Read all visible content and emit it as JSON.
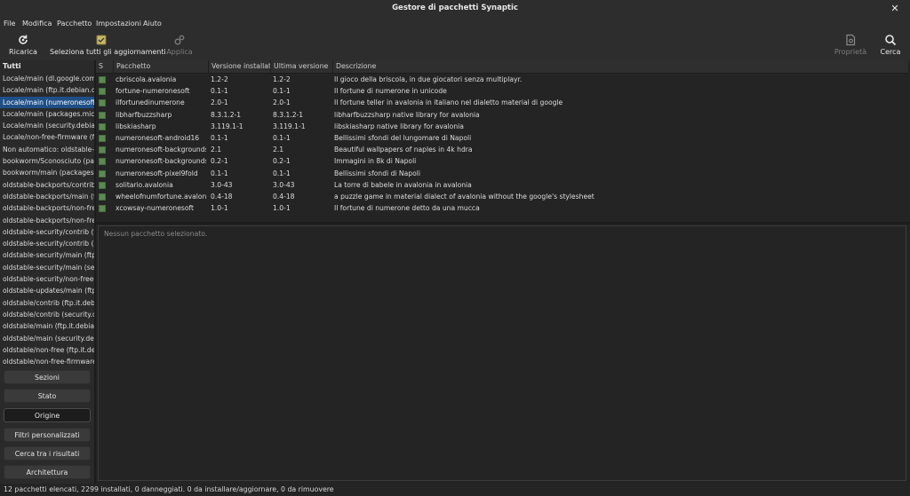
{
  "window": {
    "title": "Gestore di pacchetti Synaptic",
    "close_glyph": "✕"
  },
  "menu": [
    "File",
    "Modifica",
    "Pacchetto",
    "Impostazioni",
    "Aiuto"
  ],
  "toolbar": {
    "reload": "Ricarica",
    "mark_upgrades": "Seleziona tutti gli aggiornamenti",
    "apply": "Applica",
    "properties": "Proprietà",
    "search": "Cerca"
  },
  "sidebar": {
    "header": "Tutti",
    "items": [
      "Locale/main (dl.google.com)",
      "Locale/main (ftp.it.debian.org)",
      "Locale/main (numeronesoft.dev)",
      "Locale/main (packages.microsoft.com)",
      "Locale/main (security.debian.org)",
      "Locale/non-free-firmware (ftp.it.debian.org)",
      "Non automatico: oldstable-backports",
      "bookworm/Sconosciuto (packages)",
      "bookworm/main (packages.microsoft.com)",
      "oldstable-backports/contrib (ftp.it.debian.org)",
      "oldstable-backports/main (ftp.it.debian.org)",
      "oldstable-backports/non-free",
      "oldstable-backports/non-free-firmware",
      "oldstable-security/contrib (ftp.it.debian.org)",
      "oldstable-security/contrib (security.debian.org)",
      "oldstable-security/main (ftp.it.debian.org)",
      "oldstable-security/main (security.debian.org)",
      "oldstable-security/non-free-firmware",
      "oldstable-updates/main (ftp.it.debian.org)",
      "oldstable/contrib (ftp.it.debian.org)",
      "oldstable/contrib (security.debian.org)",
      "oldstable/main (ftp.it.debian.org)",
      "oldstable/main (security.debian.org)",
      "oldstable/non-free (ftp.it.debian.org)",
      "oldstable/non-free-firmware (ftp.it.debian.org)"
    ],
    "selected_index": 2,
    "buttons": [
      "Sezioni",
      "Stato",
      "Origine",
      "Filtri personalizzati",
      "Cerca tra i risultati",
      "Architettura"
    ],
    "active_button_index": 2
  },
  "table": {
    "columns": [
      "S",
      "Pacchetto",
      "Versione installata",
      "Ultima versione",
      "Descrizione"
    ],
    "rows": [
      {
        "name": "cbriscola.avalonia",
        "installed": "1.2-2",
        "latest": "1.2-2",
        "desc": "Il gioco della briscola, in due giocatori senza multiplayr."
      },
      {
        "name": "fortune-numeronesoft",
        "installed": "0.1-1",
        "latest": "0.1-1",
        "desc": "Il fortune di numerone in unicode"
      },
      {
        "name": "ilfortunedinumerone",
        "installed": "2.0-1",
        "latest": "2.0-1",
        "desc": "Il fortune teller in avalonia in italiano nel dialetto material di google"
      },
      {
        "name": "libharfbuzzsharp",
        "installed": "8.3.1.2-1",
        "latest": "8.3.1.2-1",
        "desc": "libharfbuzzsharp native library for avalonia"
      },
      {
        "name": "libskiasharp",
        "installed": "3.119.1-1",
        "latest": "3.119.1-1",
        "desc": "libskiasharp native library for avalonia"
      },
      {
        "name": "numeronesoft-android16",
        "installed": "0.1-1",
        "latest": "0.1-1",
        "desc": "Bellissimi sfondi del lungomare di Napoli"
      },
      {
        "name": "numeronesoft-backgrounds",
        "installed": "2.1",
        "latest": "2.1",
        "desc": "Beautiful wallpapers of naples in 4k hdra"
      },
      {
        "name": "numeronesoft-backgrounds-old",
        "installed": "0.2-1",
        "latest": "0.2-1",
        "desc": "Immagini in 8k di Napoli"
      },
      {
        "name": "numeronesoft-pixel9fold",
        "installed": "0.1-1",
        "latest": "0.1-1",
        "desc": "Bellissimi sfondi di Napoli"
      },
      {
        "name": "solitario.avalonia",
        "installed": "3.0-43",
        "latest": "3.0-43",
        "desc": "La torre di babele in avalonia in avalonia"
      },
      {
        "name": "wheelofnumfortune.avalonia",
        "installed": "0.4-18",
        "latest": "0.4-18",
        "desc": "a puzzle game in material dialect of avalonia without the google's stylesheet"
      },
      {
        "name": "xcowsay-numeronesoft",
        "installed": "1.0-1",
        "latest": "1.0-1",
        "desc": "Il fortune di numerone detto da una mucca"
      }
    ]
  },
  "detail": {
    "placeholder": "Nessun pacchetto selezionato."
  },
  "status": "12 pacchetti elencati, 2299 installati, 0 danneggiati. 0 da installare/aggiornare, 0 da rimuovere",
  "colors": {
    "selection": "#1f4f87",
    "installed_marker": "#5c8a52",
    "background": "#242424"
  }
}
